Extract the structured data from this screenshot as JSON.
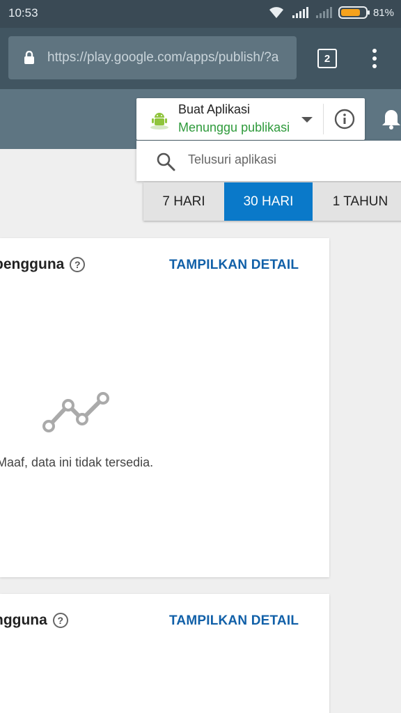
{
  "status_bar": {
    "time": "10:53",
    "battery_percent": 81,
    "battery_label": "81%",
    "colors": {
      "background": "#3a4a55",
      "battery_fill": "#f5a21c"
    }
  },
  "browser": {
    "url": "https://play.google.com/apps/publish/?a",
    "tab_count": "2",
    "icons": [
      "lock-icon",
      "overflow-menu-icon"
    ]
  },
  "app_selector": {
    "app_name": "Buat Aplikasi",
    "status": "Menunggu publikasi",
    "colors": {
      "status": "#2e9a3b",
      "header_bg": "#5e7582"
    }
  },
  "search": {
    "placeholder": "Telusuri aplikasi"
  },
  "range_tabs": {
    "items": [
      {
        "label": "7 HARI",
        "selected": false
      },
      {
        "label": "30 HARI",
        "selected": true
      },
      {
        "label": "1 TAHUN",
        "selected": false
      }
    ],
    "colors": {
      "selected": "#0a79c9"
    }
  },
  "cards": [
    {
      "title": "pengguna",
      "link_label": "TAMPILKAN DETAIL",
      "message": "Maaf, data ini tidak tersedia."
    },
    {
      "title": "ngguna",
      "link_label": "TAMPILKAN DETAIL"
    }
  ]
}
